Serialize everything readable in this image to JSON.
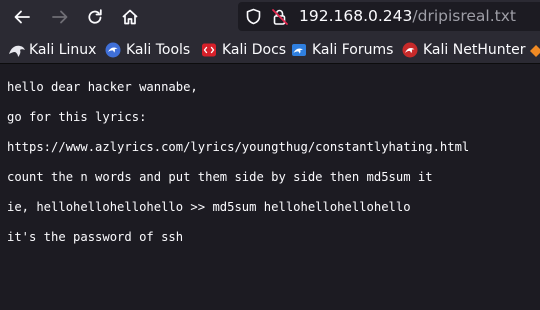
{
  "browser": {
    "url_host": "192.168.0.243",
    "url_path": "/dripisreal.txt",
    "icons": [
      "back-arrow-icon",
      "forward-arrow-icon",
      "reload-icon",
      "home-icon",
      "shield-icon",
      "insecure-lock-icon"
    ]
  },
  "bookmarks": [
    {
      "label": "Kali Linux",
      "icon": "kali-dragon-icon"
    },
    {
      "label": "Kali Tools",
      "icon": "kali-tools-icon"
    },
    {
      "label": "Kali Docs",
      "icon": "kali-docs-icon"
    },
    {
      "label": "Kali Forums",
      "icon": "kali-forums-icon"
    },
    {
      "label": "Kali NetHunter",
      "icon": "nethunter-icon"
    }
  ],
  "document": {
    "lines": [
      "hello dear hacker wannabe,",
      "go for this lyrics:",
      "https://www.azlyrics.com/lyrics/youngthug/constantlyhating.html",
      "count the n words and put them side by side then md5sum it",
      "ie, hellohellohellohello >> md5sum hellohellohellohello",
      "it's the password of ssh"
    ]
  },
  "colors": {
    "toolbar_bg": "#2b2a33",
    "page_bg": "#1c1b22",
    "text": "#fbfbfe",
    "muted_text": "#9e9ea6",
    "insecure_red": "#e22850"
  }
}
